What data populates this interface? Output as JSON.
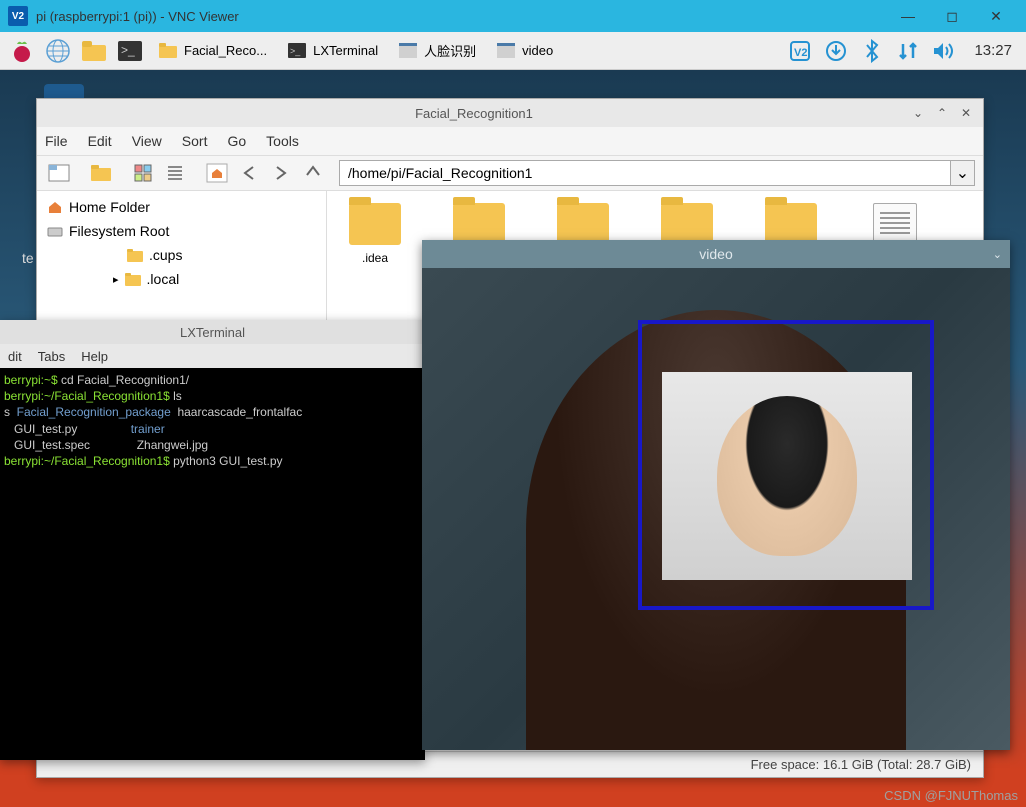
{
  "vnc": {
    "logo": "V2",
    "title": "pi (raspberrypi:1 (pi)) - VNC Viewer"
  },
  "taskbar": {
    "tasks": [
      {
        "label": "Facial_Reco..."
      },
      {
        "label": "LXTerminal"
      },
      {
        "label": "人脸识别"
      },
      {
        "label": "video"
      }
    ],
    "clock": "13:27"
  },
  "desktop": {
    "text_left": "te"
  },
  "filemgr": {
    "title": "Facial_Recognition1",
    "menu": [
      "File",
      "Edit",
      "View",
      "Sort",
      "Go",
      "Tools"
    ],
    "path": "/home/pi/Facial_Recognition1",
    "sidebar": {
      "home": "Home Folder",
      "fs": "Filesystem Root",
      "sub": [
        ".cups",
        ".local"
      ]
    },
    "files": [
      ".idea"
    ],
    "status": "Free space: 16.1 GiB (Total: 28.7 GiB)"
  },
  "terminal": {
    "title": "LXTerminal",
    "menu": [
      "dit",
      "Tabs",
      "Help"
    ],
    "lines": {
      "l1_prompt": "berrypi:~$ ",
      "l1_cmd": "cd Facial_Recognition1/",
      "l2_prompt": "berrypi:~/Facial_Recognition1$ ",
      "l2_cmd": "ls",
      "l3a": "s  ",
      "l3b": "Facial_Recognition_package",
      "l3c": "  haarcascade_frontalfac",
      "l4a": "   GUI_test.py                ",
      "l4b": "trainer",
      "l5": "   GUI_test.spec              Zhangwei.jpg",
      "l6_prompt": "berrypi:~/Facial_Recognition1$ ",
      "l6_cmd": "python3 GUI_test.py"
    }
  },
  "video": {
    "title": "video"
  },
  "watermark": "CSDN @FJNUThomas"
}
